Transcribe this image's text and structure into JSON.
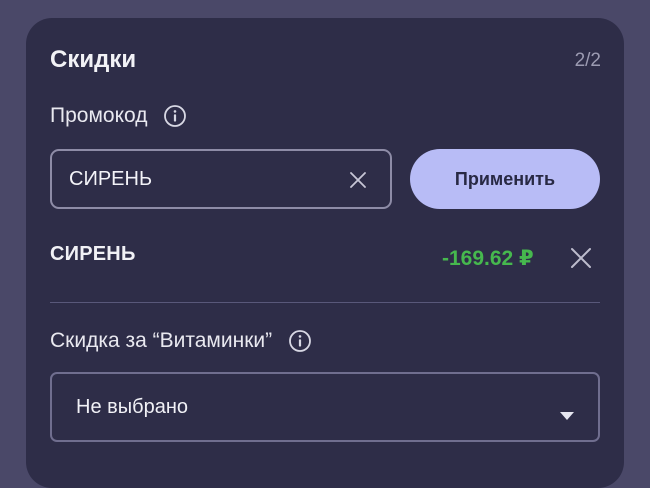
{
  "discounts": {
    "title": "Скидки",
    "counter": "2/2"
  },
  "promo": {
    "label": "Промокод",
    "value": "СИРЕНЬ",
    "apply_label": "Применить",
    "applied_code": "СИРЕНЬ",
    "applied_amount": "-169.62 ₽"
  },
  "vitamin": {
    "label": "Скидка за “Витаминки”",
    "selected": "Не выбрано"
  },
  "icons": {
    "info": "info-icon",
    "clear": "close-icon",
    "remove": "close-icon",
    "dropdown": "chevron-down-icon"
  },
  "colors": {
    "page_background": "#4a4868",
    "card_background": "#2e2d48",
    "accent_button": "#b8bcf6",
    "discount_green": "#46b84e"
  }
}
